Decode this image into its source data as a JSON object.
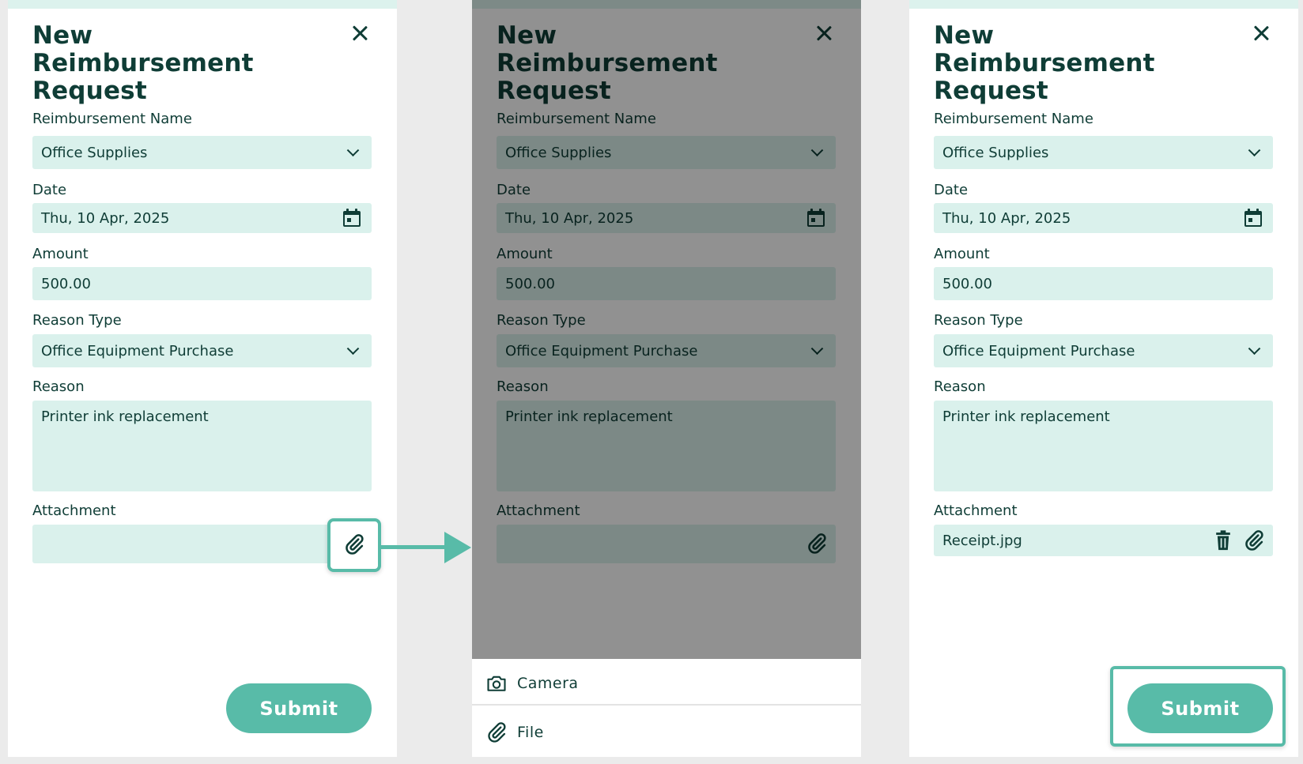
{
  "form": {
    "title": "New Reimbursement Request",
    "reimbursement_name": {
      "label": "Reimbursement Name",
      "value": "Office Supplies"
    },
    "date": {
      "label": "Date",
      "value": "Thu, 10 Apr, 2025"
    },
    "amount": {
      "label": "Amount",
      "value": "500.00"
    },
    "reason_type": {
      "label": "Reason Type",
      "value": "Office Equipment Purchase"
    },
    "reason": {
      "label": "Reason",
      "value": "Printer ink replacement"
    },
    "attachment": {
      "label": "Attachment",
      "value": "",
      "attached_value": "Receipt.jpg"
    },
    "submit_label": "Submit"
  },
  "sheet": {
    "items": [
      {
        "label": "Camera",
        "icon": "camera-icon"
      },
      {
        "label": "File",
        "icon": "paperclip-icon"
      }
    ]
  },
  "colors": {
    "accent": "#58bba8",
    "field_bg": "#daf1ec",
    "text": "#0f3d36",
    "page_bg": "#ebebeb",
    "overlay": "#8c8c8c"
  }
}
